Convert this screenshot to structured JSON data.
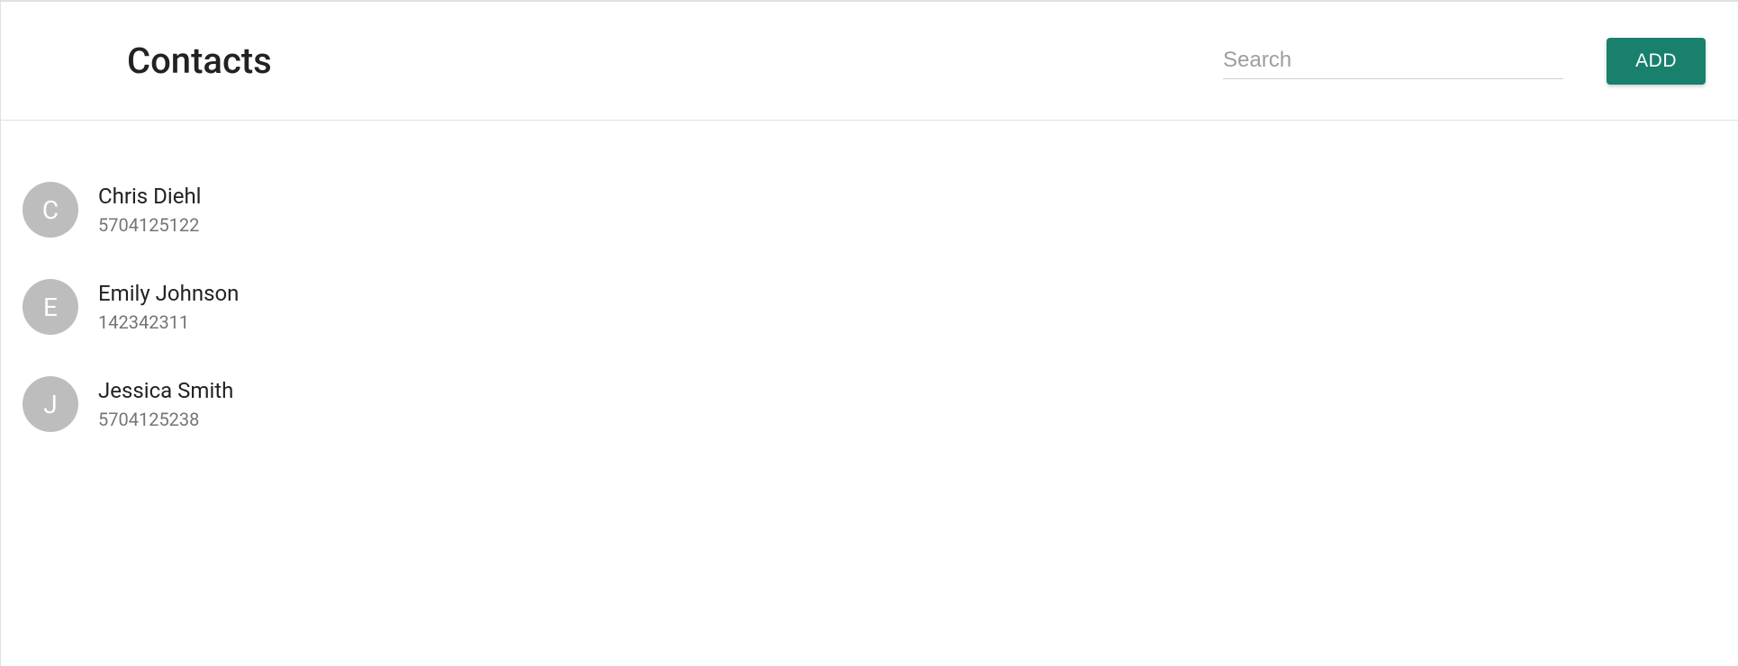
{
  "header": {
    "title": "Contacts",
    "search_placeholder": "Search",
    "add_label": "ADD"
  },
  "contacts": [
    {
      "initial": "C",
      "name": "Chris Diehl",
      "phone": "5704125122"
    },
    {
      "initial": "E",
      "name": "Emily Johnson",
      "phone": "142342311"
    },
    {
      "initial": "J",
      "name": "Jessica Smith",
      "phone": "5704125238"
    }
  ]
}
